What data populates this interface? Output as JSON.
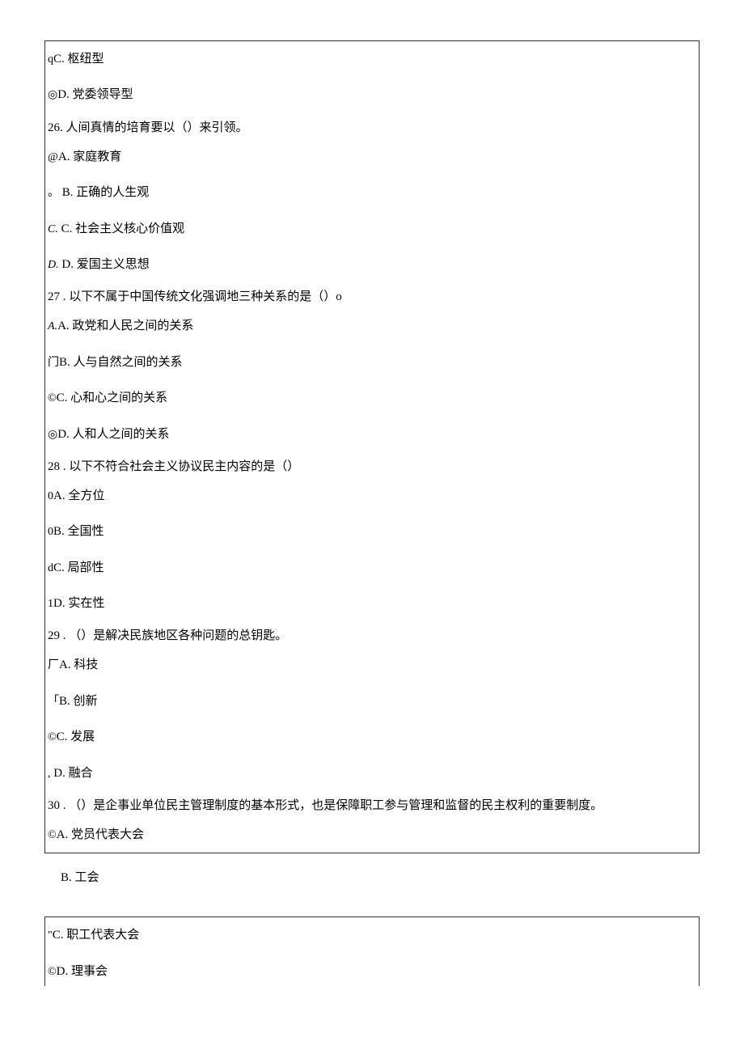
{
  "box1": {
    "l01": {
      "p": "q",
      "t": "C. 枢纽型"
    },
    "l02": {
      "p": "◎",
      "t": "D. 党委领导型"
    },
    "q26": "26. 人间真情的培育要以（）来引领。",
    "l03": {
      "p": "@",
      "t": "A. 家庭教育"
    },
    "l04": {
      "p": "。",
      "t": "B. 正确的人生观"
    },
    "l05": {
      "p": "C.",
      "t": "C. 社会主义核心价值观"
    },
    "l06": {
      "p": "D.",
      "t": "D. 爱国主义思想"
    },
    "q27": "27 . 以下不属于中国传统文化强调地三种关系的是（）o",
    "l07": {
      "p": "A.",
      "t": "A. 政党和人民之间的关系"
    },
    "l08": {
      "p": "门",
      "t": "B. 人与自然之间的关系"
    },
    "l09": {
      "p": "©",
      "t": "C. 心和心之间的关系"
    },
    "l10": {
      "p": "◎",
      "t": "D. 人和人之间的关系"
    },
    "q28": "28 . 以下不符合社会主义协议民主内容的是（）",
    "l11": {
      "p": "0",
      "t": "A. 全方位"
    },
    "l12": {
      "p": "0",
      "t": "B. 全国性"
    },
    "l13": {
      "p": "d",
      "t": "C. 局部性"
    },
    "l14": {
      "p": "1",
      "t": "D. 实在性"
    },
    "q29": "29 . （）是解决民族地区各种问题的总钥匙。",
    "l15": {
      "p": "厂",
      "t": "A. 科技"
    },
    "l16": {
      "p": "「",
      "t": "B. 创新"
    },
    "l17": {
      "p": "©",
      "t": "C. 发展"
    },
    "l18": {
      "p": ",",
      "t": "D. 融合"
    },
    "q30": "30 . （）是企事业单位民主管理制度的基本形式，也是保障职工参与管理和监督的民主权利的重要制度。",
    "l19": {
      "p": "©",
      "t": "A. 党员代表大会"
    }
  },
  "standalone": "B. 工会",
  "box2": {
    "l20": {
      "p": "\"",
      "t": "C. 职工代表大会"
    },
    "l21": {
      "p": "©",
      "t": "D. 理事会"
    }
  }
}
